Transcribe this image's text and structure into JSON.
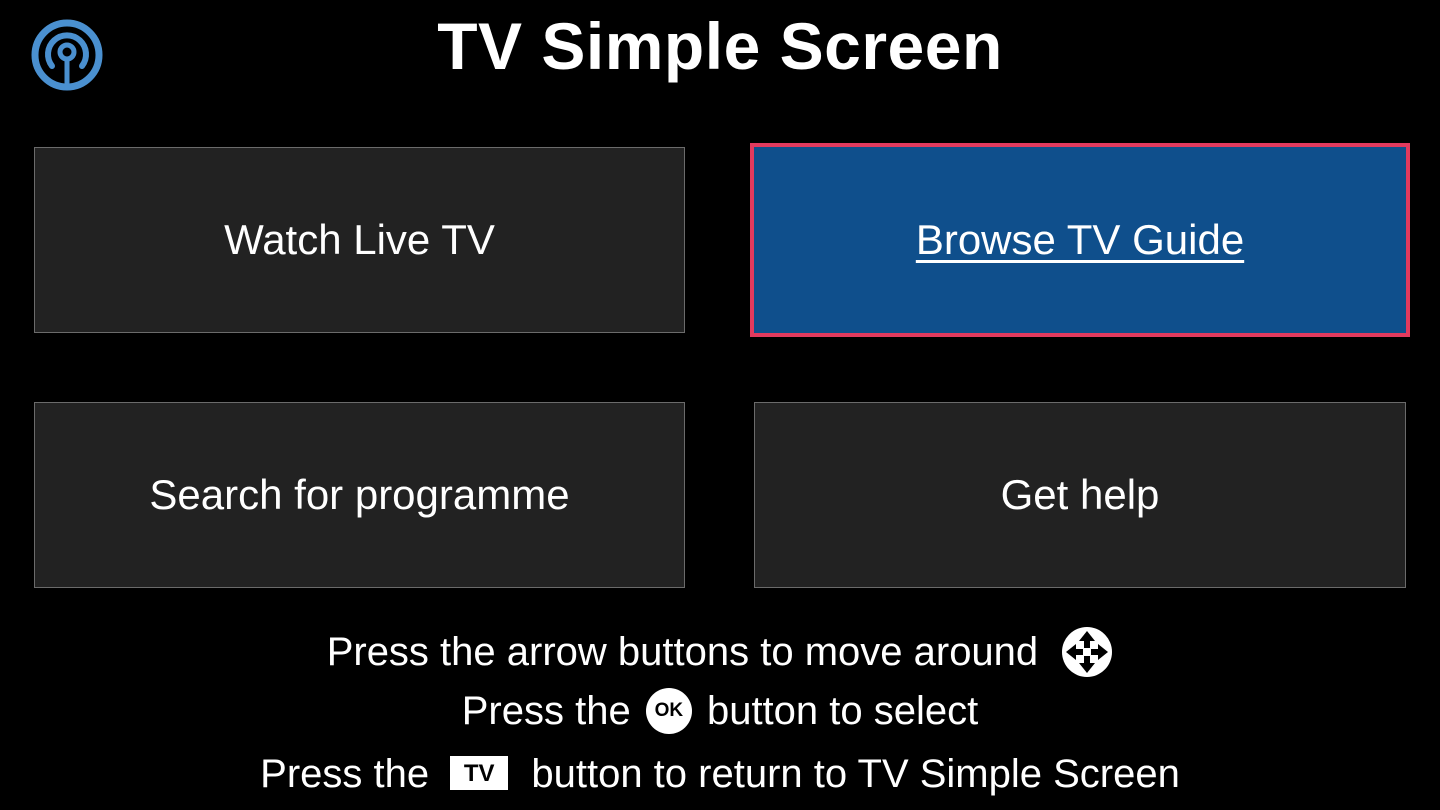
{
  "header": {
    "title": "TV Simple Screen",
    "logo_icon": "broadcast-signal-icon",
    "logo_color": "#4a90d0"
  },
  "menu": {
    "tiles": [
      {
        "label": "Watch Live TV",
        "focused": false
      },
      {
        "label": "Browse TV Guide",
        "focused": true
      },
      {
        "label": "Search for programme",
        "focused": false
      },
      {
        "label": "Get help",
        "focused": false
      }
    ]
  },
  "instructions": {
    "line1": "Press the arrow buttons to move around",
    "line1_icon": "arrow-pad-icon",
    "line2_before": "Press the",
    "line2_badge": "OK",
    "line2_after": "button to select",
    "line3_before": "Press the",
    "line3_badge": "TV",
    "line3_after": "button to return to TV Simple Screen"
  },
  "colors": {
    "background": "#000000",
    "tile": "#222222",
    "tile_focused": "#0f4f8c",
    "focus_border": "#e23a5e",
    "text": "#ffffff"
  }
}
